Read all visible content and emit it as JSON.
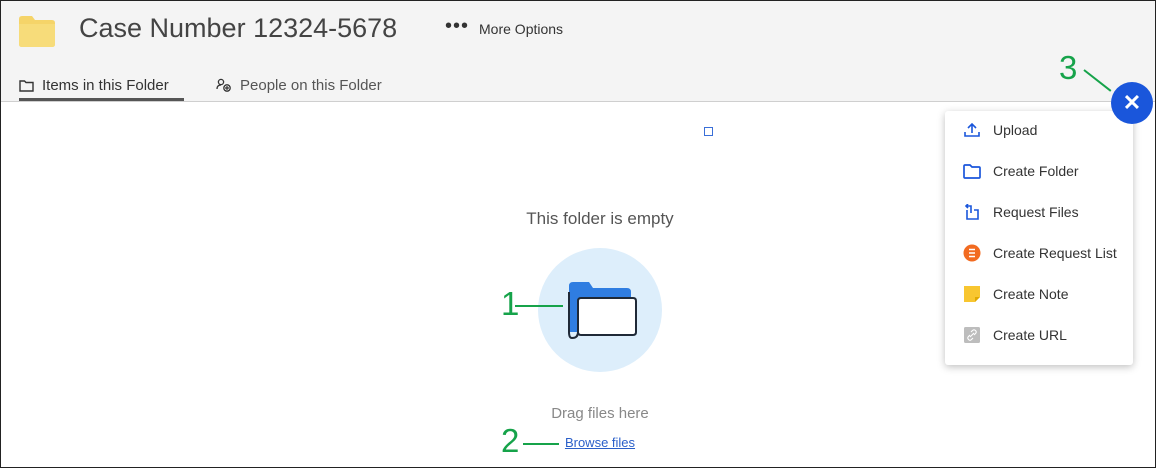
{
  "header": {
    "title": "Case Number 12324-5678",
    "more_dots": "•••",
    "more_label": "More Options"
  },
  "tabs": [
    {
      "label": "Items in this Folder",
      "active": true
    },
    {
      "label": "People on this Folder",
      "active": false
    }
  ],
  "empty_state": {
    "message": "This folder is empty",
    "drag_text": "Drag files here",
    "browse_link": "Browse files"
  },
  "annotations": [
    "1",
    "2",
    "3"
  ],
  "fab": {
    "symbol": "✕"
  },
  "menu": {
    "items": [
      {
        "label": "Upload",
        "icon": "upload-icon"
      },
      {
        "label": "Create Folder",
        "icon": "folder-outline-icon"
      },
      {
        "label": "Request Files",
        "icon": "request-files-icon"
      },
      {
        "label": "Create Request List",
        "icon": "request-list-icon"
      },
      {
        "label": "Create Note",
        "icon": "note-icon"
      },
      {
        "label": "Create URL",
        "icon": "link-icon"
      }
    ]
  },
  "colors": {
    "accent_blue": "#1a56db",
    "annotation_green": "#16a34a",
    "folder_yellow": "#f5d469",
    "request_list_orange": "#f26b21",
    "note_yellow": "#f8c630"
  }
}
